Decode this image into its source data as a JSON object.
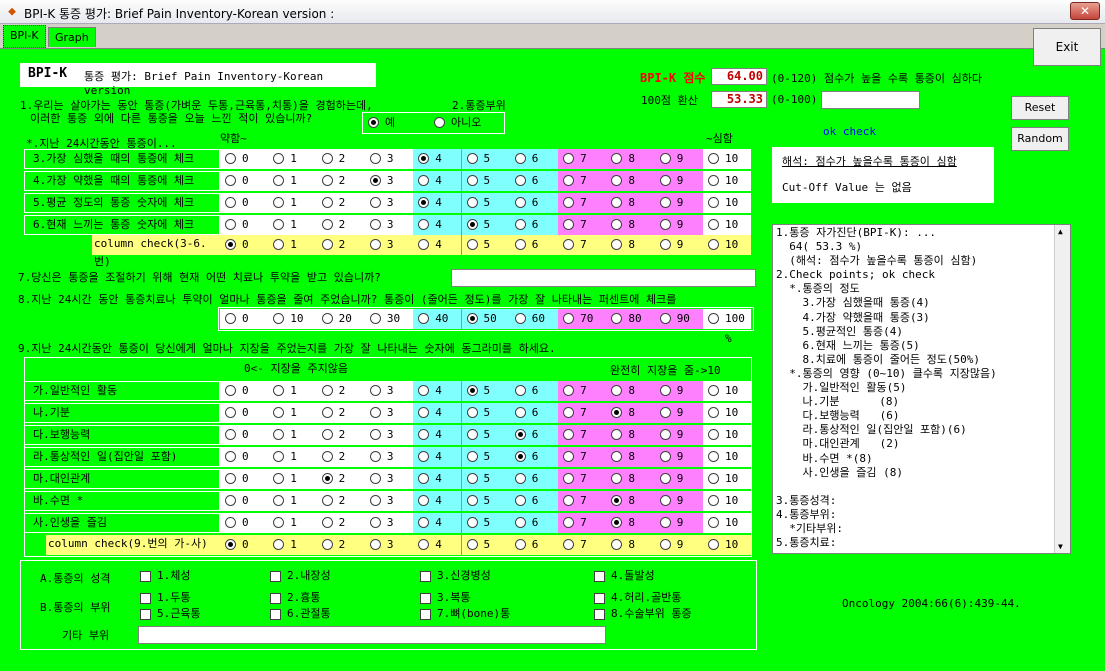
{
  "window": {
    "title": "BPI-K 통증 평가: Brief Pain Inventory-Korean version :",
    "close": "✕"
  },
  "tabs": [
    "BPI-K",
    "Graph"
  ],
  "header": {
    "brand": "BPI-K",
    "subtitle": "통증 평가: Brief Pain Inventory-Korean version"
  },
  "score": {
    "label": "BPI-K 점수",
    "value": "64.00",
    "range": "(0-120) 점수가 높을 수록 통증이 심하다",
    "conv_label": "100점 환산",
    "conv_value": "53.33",
    "conv_range": "(0-100)",
    "conv_input": ""
  },
  "buttons": {
    "exit": "Exit",
    "reset": "Reset",
    "random": "Random"
  },
  "ok_check": "ok check",
  "interpret": {
    "title": "해석: 점수가 높을수록 통증이 심함",
    "cutoff": "Cut-Off Value 는 없음"
  },
  "q1": {
    "text1": "1.우리는 살아가는 동안 통증(가벼운 두통,근육통,치통)을 경험하는데,",
    "text2": "이러한 통증 외에 다른 통증을 오늘 느낀 적이 있습니까?",
    "yes": "예",
    "no": "아니오",
    "selected": "yes"
  },
  "q2": "2.통증부위",
  "sec3": {
    "title": "*.지난 24시간동안 통증이...",
    "weak": "약함~",
    "strong": "~심함"
  },
  "pain_rows": [
    {
      "label": "3.가장 심했을 때의 통증에 체크",
      "sel": 4
    },
    {
      "label": "4.가장 약했을 때의 통증에 체크",
      "sel": 3
    },
    {
      "label": "5.평균 정도의 통증 숫자에 체크",
      "sel": 4
    },
    {
      "label": "6.현재 느끼는 통증 숫자에 체크",
      "sel": 5
    },
    {
      "label": "column check(3-6.번)",
      "sel": 0
    }
  ],
  "nums": [
    "0",
    "1",
    "2",
    "3",
    "4",
    "5",
    "6",
    "7",
    "8",
    "9",
    "10"
  ],
  "q7": "7.당신은 통증을 조절하기 위해 현재 어떤 치료나 투약을 받고 있습니까?",
  "q7_input": "",
  "q8": "8.지난 24시간 동안 통증치료나 투약이 얼마나 통증을 줄여 주었습니까?   통증이 (줄어든 정도)를 가장 잘 나타내는 퍼센트에 체크를",
  "q8_opts": [
    "0",
    "10",
    "20",
    "30",
    "40",
    "50",
    "60",
    "70",
    "80",
    "90",
    "100 %"
  ],
  "q8_sel": 5,
  "q9": "9.지난 24시간동안 통증이 당신에게 얼마나 지장을 주었는지를 가장 잘 나타내는 숫자에 동그라미를 하세요.",
  "q9_left": "0<- 지장을 주지않음",
  "q9_right": "완전히 지장을 줌->10",
  "inter_rows": [
    {
      "label": "가.일반적인 활동",
      "sel": 5
    },
    {
      "label": "나.기분",
      "sel": 8
    },
    {
      "label": "다.보행능력",
      "sel": 6
    },
    {
      "label": "라.통상적인 일(집안일 포함)",
      "sel": 6
    },
    {
      "label": "마.대인관계",
      "sel": 2
    },
    {
      "label": "바.수면 *",
      "sel": 8
    },
    {
      "label": "사.인생을 즐김",
      "sel": 8
    },
    {
      "label": "column check(9.번의 가-사)",
      "sel": 0
    }
  ],
  "natureA": {
    "label": "A.통증의 성격",
    "items": [
      "1.체성",
      "2.내장성",
      "3.신경병성",
      "4.돌발성"
    ]
  },
  "siteB": {
    "label": "B.통증의 부위",
    "row1": [
      "1.두통",
      "2.흉통",
      "3.복통",
      "4.허리.골반통"
    ],
    "row2": [
      "5.근육통",
      "6.관절통",
      "7.뼈(bone)통",
      "8.수술부위 통증"
    ]
  },
  "other": {
    "label": "기타 부위",
    "value": ""
  },
  "citation": "Oncology 2004:66(6):439-44.",
  "report": [
    "1.통증 자가진단(BPI-K): ...",
    "  64( 53.3 %)",
    "  (해석: 점수가 높을수록 통증이 심함)",
    "2.Check points; ok check",
    "  *.통증의 정도",
    "    3.가장 심했을때 통증(4)",
    "    4.가장 약했을때 통증(3)",
    "    5.평균적인 통증(4)",
    "    6.현재 느끼는 통증(5)",
    "    8.치료에 통증이 줄어든 정도(50%)",
    "  *.통증의 영향 (0~10) 클수록 지장많음)",
    "    가.일반적인 활동(5)",
    "    나.기분      (8)",
    "    다.보행능력   (6)",
    "    라.통상적인 일(집안일 포함)(6)",
    "    마.대인관계   (2)",
    "    바.수면 *(8)",
    "    사.인생을 즐김 (8)",
    "",
    "3.통증성격:",
    "4.통증부위:",
    "  *기타부위:",
    "5.통증치료:"
  ],
  "colors": {
    "bg": "#00ff00",
    "cyan": "#80ffff",
    "magenta": "#ff80ff",
    "yellow": "#ffff80",
    "value_red": "#c00000",
    "brand_red": "#ff0000",
    "okcheck": "#0000ff"
  }
}
